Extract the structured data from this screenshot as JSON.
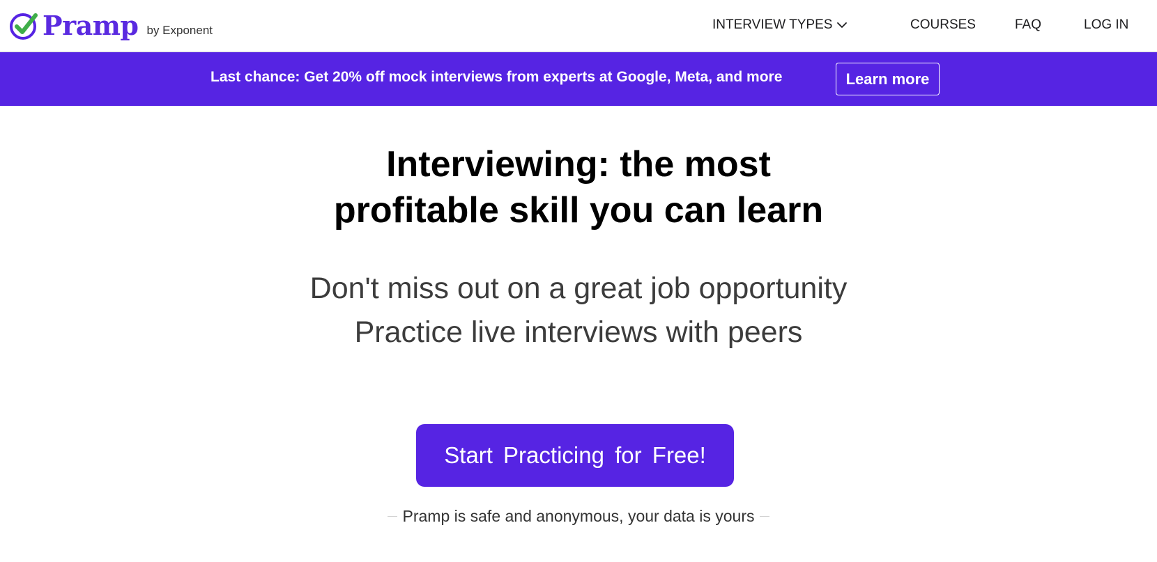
{
  "brand": {
    "name": "Pramp",
    "byline": "by Exponent",
    "accent_color": "#5624e3",
    "check_color": "#3fae49"
  },
  "nav": {
    "interview_types": "INTERVIEW TYPES",
    "courses": "COURSES",
    "faq": "FAQ",
    "login": "LOG IN"
  },
  "banner": {
    "text": "Last chance: Get 20% off mock interviews from experts at Google, Meta, and more",
    "button_label": "Learn more"
  },
  "hero": {
    "title_line1": "Interviewing: the most",
    "title_line2": "profitable skill you can learn",
    "subtitle_line1": "Don't miss out on a great job opportunity",
    "subtitle_line2": "Practice live interviews with peers",
    "cta_label": "Start Practicing for Free!",
    "safe_note": "Pramp is safe and anonymous, your data is yours"
  }
}
